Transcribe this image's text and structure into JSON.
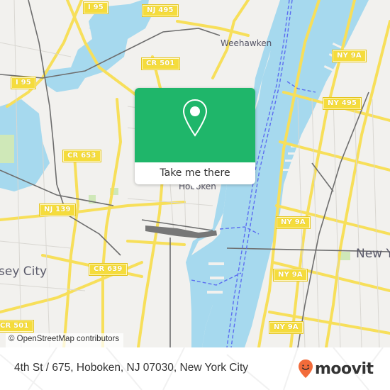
{
  "map": {
    "shields": [
      {
        "label": "I 95"
      },
      {
        "label": "NJ 495"
      },
      {
        "label": "CR 501"
      },
      {
        "label": "I 95"
      },
      {
        "label": "NY 9A"
      },
      {
        "label": "NY 495"
      },
      {
        "label": "CR 653"
      },
      {
        "label": "NJ 139"
      },
      {
        "label": "NY 9A"
      },
      {
        "label": "NY 9A"
      },
      {
        "label": "CR 639"
      },
      {
        "label": "NY 9A"
      },
      {
        "label": "CR 501"
      }
    ],
    "places": [
      {
        "label": "Weehawken"
      },
      {
        "label": "Hoboken"
      },
      {
        "label": "New Y"
      },
      {
        "label": "sey City"
      }
    ],
    "attribution": "© OpenStreetMap contributors",
    "colors": {
      "water": "#a6d9ee",
      "land": "#f2f1ee",
      "road": "#f7df5a",
      "rail": "#6e6e6e",
      "ferry": "#5c6ef0",
      "park": "#cfe8b8"
    }
  },
  "popup": {
    "icon": "map-pin-icon",
    "button_label": "Take me there",
    "color": "#1fb66a"
  },
  "footer": {
    "address": "4th St / 675, Hoboken, NJ 07030, New York City",
    "brand": "moovit",
    "brand_icon": "moovit-smile-pin-icon",
    "brand_color": "#f26b3a"
  }
}
